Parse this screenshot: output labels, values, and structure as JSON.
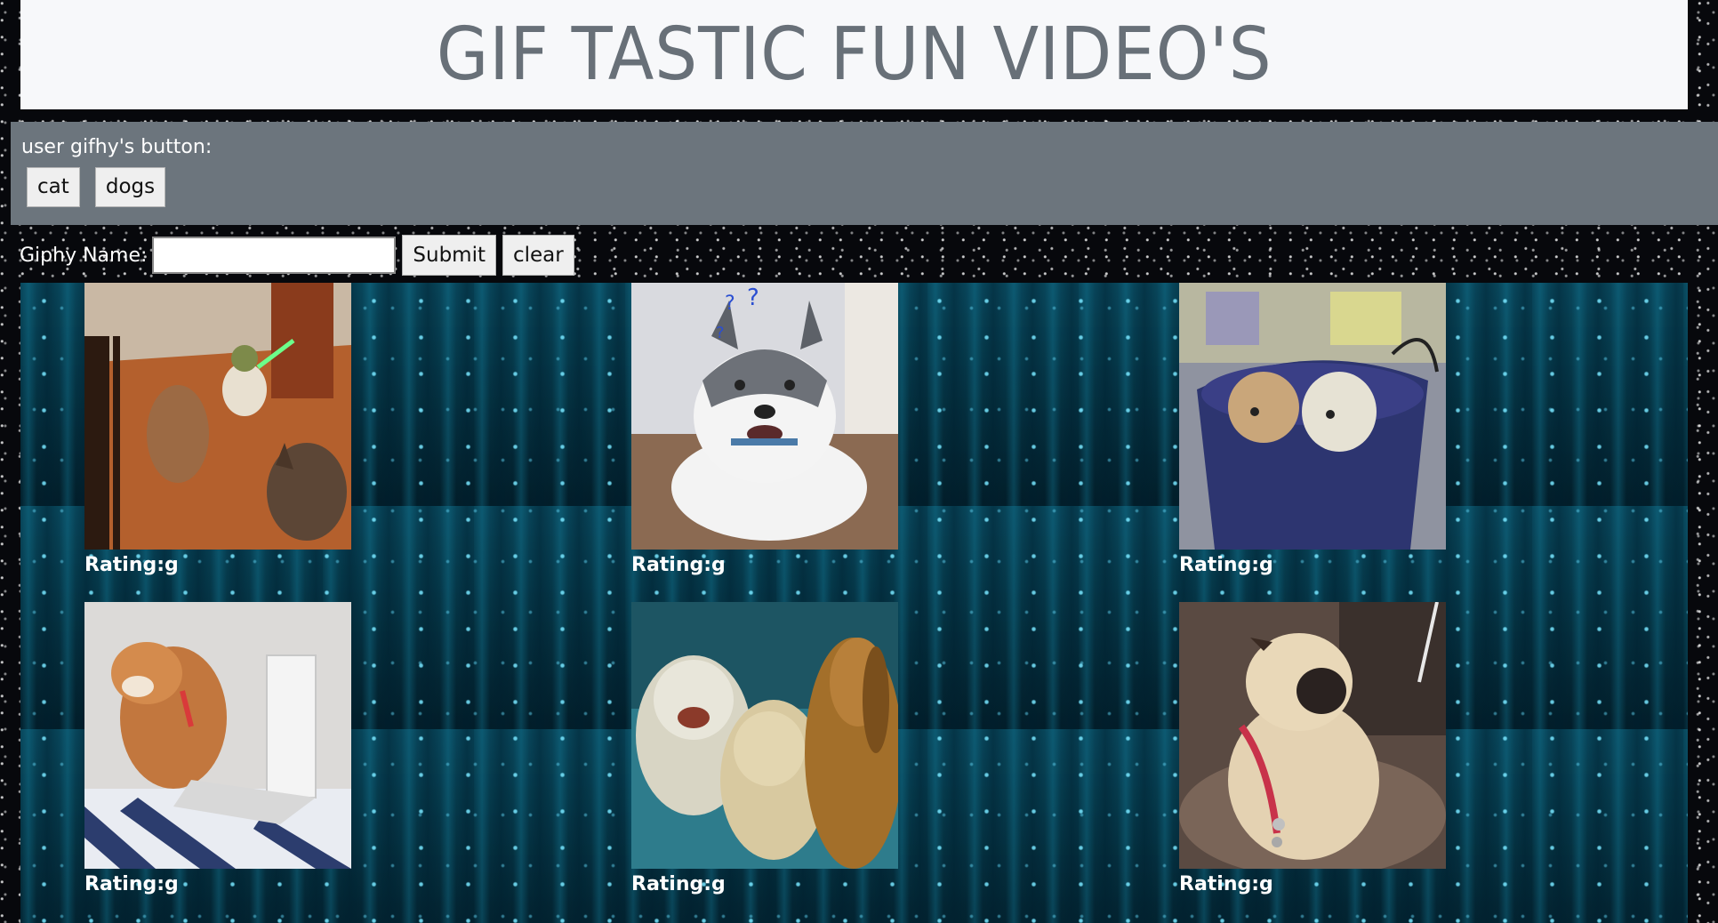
{
  "header": {
    "title": "GIF TASTIC FUN VIDEO'S"
  },
  "button_bar": {
    "label": "user gifhy's button:",
    "topics": [
      "cat",
      "dogs"
    ]
  },
  "form": {
    "label": "Giphy Name:",
    "input_value": "",
    "submit_label": "Submit",
    "clear_label": "clear"
  },
  "gallery": {
    "items": [
      {
        "rating": "Rating:g",
        "subject": "yoda-costume-dog-gif"
      },
      {
        "rating": "Rating:g",
        "subject": "husky-confused-gif"
      },
      {
        "rating": "Rating:g",
        "subject": "dogs-in-bucket-gif"
      },
      {
        "rating": "Rating:g",
        "subject": "shiba-laptop-gif"
      },
      {
        "rating": "Rating:g",
        "subject": "three-dogs-gif"
      },
      {
        "rating": "Rating:g",
        "subject": "pug-sitting-gif"
      }
    ]
  }
}
